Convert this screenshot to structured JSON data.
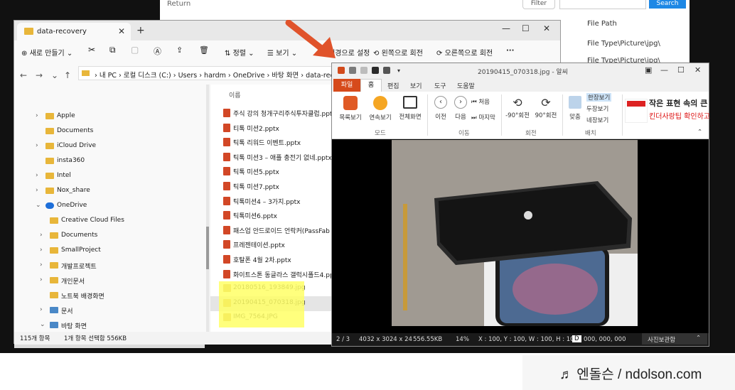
{
  "background_app": {
    "search_label": "Return",
    "filter_label": "Filter",
    "search_placeholder": "Search Files...",
    "search_button": "Search",
    "column_header": "File Path",
    "row1": "File Type\\Picture\\jpg\\",
    "row2": "File Type\\Picture\\jpg\\"
  },
  "explorer": {
    "tab_title": "data-recovery",
    "commands": [
      "새로 만들기",
      "정렬",
      "보기",
      "배경으로 설정",
      "왼쪽으로 회전",
      "오른쪽으로 회전",
      "···"
    ],
    "address_path": "›  내 PC  ›  로컬 디스크 (C:)  ›  Users  ›  hardm  ›  OneDrive  ›  바탕 화면  ›  data-recovery",
    "nav_items": [
      {
        "label": "Apple",
        "depth": 1,
        "expand": "›"
      },
      {
        "label": "Documents",
        "depth": 1,
        "expand": ""
      },
      {
        "label": "iCloud Drive",
        "depth": 1,
        "expand": "›"
      },
      {
        "label": "insta360",
        "depth": 1,
        "expand": ""
      },
      {
        "label": "Intel",
        "depth": 1,
        "expand": "›"
      },
      {
        "label": "Nox_share",
        "depth": 1,
        "expand": "›"
      },
      {
        "label": "OneDrive",
        "depth": 1,
        "expand": "⌄"
      },
      {
        "label": "Creative Cloud Files",
        "depth": 2,
        "expand": ""
      },
      {
        "label": "Documents",
        "depth": 2,
        "expand": "›"
      },
      {
        "label": "SmallProject",
        "depth": 2,
        "expand": "›"
      },
      {
        "label": "개발프로젝트",
        "depth": 2,
        "expand": "›"
      },
      {
        "label": "개인문서",
        "depth": 2,
        "expand": "›"
      },
      {
        "label": "노트북 배경화면",
        "depth": 2,
        "expand": ""
      },
      {
        "label": "문서",
        "depth": 2,
        "expand": "›"
      },
      {
        "label": "바탕 화면",
        "depth": 2,
        "expand": "⌄"
      },
      {
        "label": "data-recovery",
        "depth": 3,
        "expand": ""
      }
    ],
    "column_name": "이름",
    "files": [
      {
        "name": "주식 강의 청개구리주식투자클럽.pptx",
        "type": "pptx"
      },
      {
        "name": "티톡 미션2.pptx",
        "type": "pptx"
      },
      {
        "name": "틱톡 리워드 이벤트.pptx",
        "type": "pptx"
      },
      {
        "name": "틱톡 미션3 – 애플 충전기 없네.pptx",
        "type": "pptx"
      },
      {
        "name": "틱톡 미션5.pptx",
        "type": "pptx"
      },
      {
        "name": "틱톡 미션7.pptx",
        "type": "pptx"
      },
      {
        "name": "틱톡미션4 – 3가지.pptx",
        "type": "pptx"
      },
      {
        "name": "틱톡미션6.pptx",
        "type": "pptx"
      },
      {
        "name": "패스업 안드로이드 언락커(PassFab Andr",
        "type": "pptx"
      },
      {
        "name": "프레젠테이션.pptx",
        "type": "pptx"
      },
      {
        "name": "호탈폰 4월 2차.pptx",
        "type": "pptx"
      },
      {
        "name": "화이트스톤 동글라스 갤럭시폴드4.pptx",
        "type": "pptx"
      },
      {
        "name": "20180516_193849.jpg",
        "type": "jpg"
      },
      {
        "name": "20190415_070318.jpg",
        "type": "jpg"
      },
      {
        "name": "IMG_7564.JPG",
        "type": "jpg"
      }
    ],
    "status_count": "115개 항목",
    "status_selected": "1개 항목 선택함 556KB"
  },
  "viewer": {
    "title": "20190415_070318.jpg - 알씨",
    "tabs": [
      "파일",
      "홈",
      "편집",
      "보기",
      "도구",
      "도움말"
    ],
    "buttons": {
      "list": "목록보기",
      "slideshow": "연속보기",
      "fullscreen": "전체화면",
      "prev": "이전",
      "next": "다음",
      "first": "처음",
      "last": "마지막",
      "rotate_left": "-90°회전",
      "rotate_right": "90°회전",
      "fit": "맞춤",
      "single": "한장보기",
      "double": "두장보기",
      "quad": "네장보기"
    },
    "groups": {
      "mode": "모드",
      "move": "이동",
      "rotate": "회전",
      "layout": "배치"
    },
    "ad_line1": "작은 표현 속의 큰",
    "ad_line2": "킨더사랑팁 확인하고",
    "ad_logo_text": "Kinder CHOCOLATE",
    "status": {
      "index": "2 / 3",
      "dims": "4032 x 3024 x 24",
      "size": "556.55KB",
      "zoom": "14%",
      "coords": "X : 100, Y : 100, W : 100, H : 100",
      "d": "D",
      "rgb": "000, 000, 000",
      "storage": "사진보관함"
    }
  },
  "credit": "♬ 엔돌슨 / ndolson.com",
  "colors": {
    "arrow": "#e0532b",
    "highlight": "#ffff66",
    "viewer_accent": "#d64a1b",
    "folder": "#e8b63a"
  }
}
